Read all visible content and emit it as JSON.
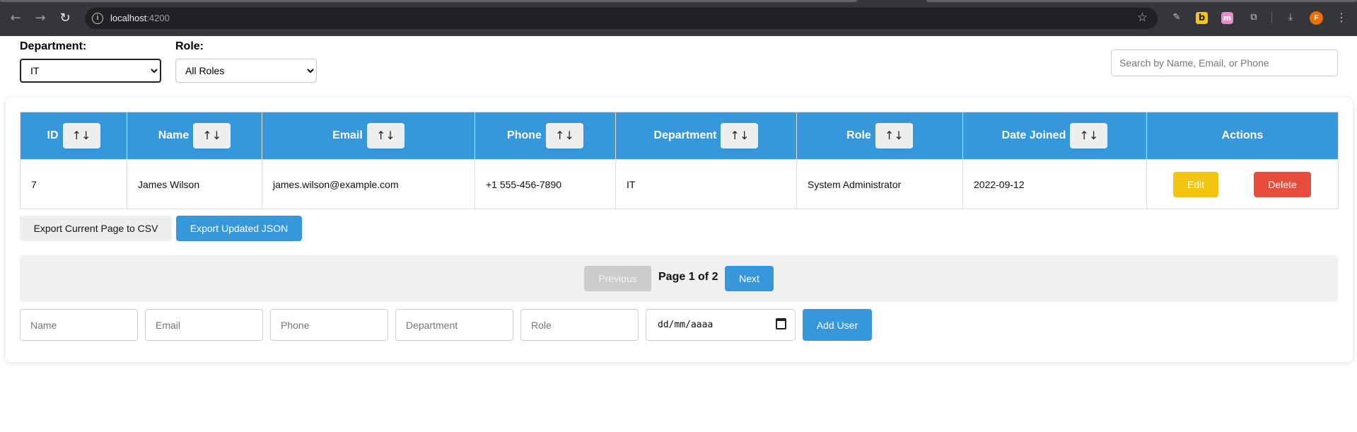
{
  "browser": {
    "url_host": "localhost",
    "url_port": ":4200"
  },
  "filters": {
    "department_label": "Department:",
    "department_selected": "IT",
    "role_label": "Role:",
    "role_selected": "All Roles",
    "search_placeholder": "Search by Name, Email, or Phone"
  },
  "table": {
    "sort_glyph": "↑↓",
    "columns": [
      "ID",
      "Name",
      "Email",
      "Phone",
      "Department",
      "Role",
      "Date Joined",
      "Actions"
    ],
    "rows": [
      {
        "id": "7",
        "name": "James Wilson",
        "email": "james.wilson@example.com",
        "phone": "+1 555-456-7890",
        "department": "IT",
        "role": "System Administrator",
        "date_joined": "2022-09-12"
      }
    ],
    "edit_label": "Edit",
    "delete_label": "Delete"
  },
  "exports": {
    "csv_label": "Export Current Page to CSV",
    "json_label": "Export Updated JSON"
  },
  "pagination": {
    "prev_label": "Previous",
    "page_info": "Page 1 of 2",
    "next_label": "Next"
  },
  "add_form": {
    "name_placeholder": "Name",
    "email_placeholder": "Email",
    "phone_placeholder": "Phone",
    "department_placeholder": "Department",
    "role_placeholder": "Role",
    "date_placeholder": "dd/mm/aaaa",
    "add_label": "Add User"
  },
  "colors": {
    "primary": "#3797db",
    "edit": "#f1c40f",
    "delete": "#e74c3c"
  }
}
